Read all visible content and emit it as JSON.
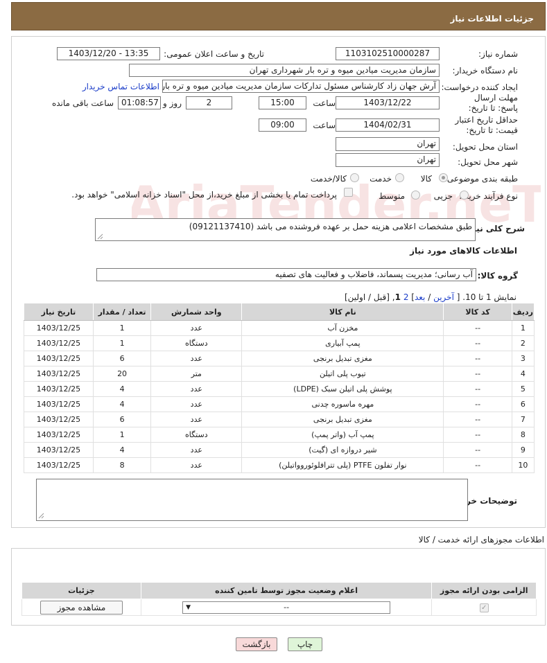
{
  "header": {
    "title": "جزئیات اطلاعات نیاز"
  },
  "form": {
    "need_number": {
      "label": "شماره نیاز:",
      "value": "1103102510000287"
    },
    "announce_datetime": {
      "label": "تاریخ و ساعت اعلان عمومی:",
      "value": "1403/12/20 - 13:35"
    },
    "buyer_org": {
      "label": "نام دستگاه خریدار:",
      "value": "سازمان مدیریت میادین میوه و تره بار شهرداری تهران"
    },
    "requester": {
      "label": "ایجاد کننده درخواست:",
      "value": "آرش جهان زاد کارشناس مسئول تدارکات سازمان مدیریت میادین میوه و تره بار ش",
      "contact_link": "اطلاعات تماس خریدار"
    },
    "reply_deadline": {
      "label": "مهلت ارسال پاسخ: تا تاریخ:",
      "date": "1403/12/22",
      "time_label": "ساعت",
      "time": "15:00",
      "days": "2",
      "days_label": "روز و",
      "remaining": "01:08:57",
      "remaining_label": "ساعت باقی مانده"
    },
    "price_validity": {
      "label": "حداقل تاریخ اعتبار قیمت: تا تاریخ:",
      "date": "1404/02/31",
      "time_label": "ساعت",
      "time": "09:00"
    },
    "delivery_province": {
      "label": "استان محل تحویل:",
      "value": "تهران"
    },
    "delivery_city": {
      "label": "شهر محل تحویل:",
      "value": "تهران"
    },
    "category": {
      "label": "طبقه بندی موضوعی:",
      "options": [
        "کالا",
        "خدمت",
        "کالا/خدمت"
      ],
      "selected": "کالا"
    },
    "purchase_process": {
      "label": "نوع فرآیند خرید :",
      "options": [
        "جزیی",
        "متوسط"
      ],
      "payment_note": "پرداخت تمام یا بخشی از مبلغ خرید،از محل \"اسناد خزانه اسلامی\" خواهد بود."
    },
    "description": {
      "label": "شرح کلی نیاز:",
      "value": "طبق مشخصات اعلامی هزینه حمل بر عهده فروشنده می باشد (09121137410)"
    },
    "goods_info_title": "اطلاعات کالاهای مورد نیاز",
    "goods_group": {
      "label": "گروه کالا:",
      "value": "آب رسانی؛ مدیریت پسماند، فاضلاب و فعالیت های تصفیه"
    }
  },
  "pagination": {
    "text_prefix": "نمایش 1 تا 10. [",
    "last": "آخرین",
    "slash1": " / ",
    "next": "بعد",
    "page2": "2",
    "current": "1",
    "text_suffix": "[قبل / اولین]"
  },
  "items_table": {
    "headers": [
      "ردیف",
      "کد کالا",
      "نام کالا",
      "واحد شمارش",
      "تعداد / مقدار",
      "تاریخ نیاز"
    ],
    "rows": [
      [
        "1",
        "--",
        "مخزن آب",
        "عدد",
        "1",
        "1403/12/25"
      ],
      [
        "2",
        "--",
        "پمپ آبیاری",
        "دستگاه",
        "1",
        "1403/12/25"
      ],
      [
        "3",
        "--",
        "مغزی تبدیل برنجی",
        "عدد",
        "6",
        "1403/12/25"
      ],
      [
        "4",
        "--",
        "تیوب پلی اتیلن",
        "متر",
        "20",
        "1403/12/25"
      ],
      [
        "5",
        "--",
        "پوشش پلی اتیلن سبک (LDPE)",
        "عدد",
        "4",
        "1403/12/25"
      ],
      [
        "6",
        "--",
        "مهره ماسوره چدنی",
        "عدد",
        "4",
        "1403/12/25"
      ],
      [
        "7",
        "--",
        "مغزی تبدیل برنجی",
        "عدد",
        "6",
        "1403/12/25"
      ],
      [
        "8",
        "--",
        "پمپ آب (واتر پمپ)",
        "دستگاه",
        "1",
        "1403/12/25"
      ],
      [
        "9",
        "--",
        "شیر دروازه ای (گیت)",
        "عدد",
        "4",
        "1403/12/25"
      ],
      [
        "10",
        "--",
        "نوار تفلون PTFE (پلی تترافلوئوروواتیلن)",
        "عدد",
        "8",
        "1403/12/25"
      ]
    ]
  },
  "buyer_notes": {
    "label": "توضیحات خریدار:",
    "value": ""
  },
  "permits": {
    "title": "اطلاعات مجوزهای ارائه خدمت / کالا",
    "headers": [
      "الزامی بودن ارائه مجوز",
      "اعلام وضعیت مجوز توسط تامین کننده",
      "جزئیات"
    ],
    "select_value": "--",
    "view_button": "مشاهده مجوز"
  },
  "actions": {
    "print": "چاپ",
    "back": "بازگشت"
  },
  "watermark_text": "AriaTender.neT",
  "colors": {
    "header_bg": "#8b6b43",
    "link": "#1a3cc8",
    "back_btn_bg": "#f8d9d9",
    "print_btn_bg": "#dff5d8"
  }
}
